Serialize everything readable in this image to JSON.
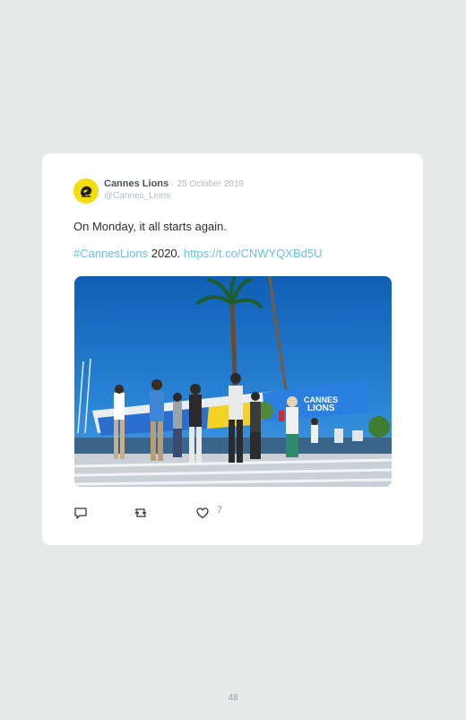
{
  "tweet": {
    "author_name": "Cannes Lions",
    "separator": "·",
    "date": "25 October 2019",
    "handle": "@Cannes_Lions",
    "text_line1": "On Monday, it all starts again.",
    "hashtag": "#CannesLions",
    "year": " 2020. ",
    "link": "https://t.co/CNWYQXBd5U",
    "photo_sign_line1": "CANNES",
    "photo_sign_line2": "LIONS",
    "like_count": "7"
  },
  "icons": {
    "reply": "reply-icon",
    "retweet": "retweet-icon",
    "like": "heart-icon",
    "avatar": "lion-logo"
  },
  "colors": {
    "avatar_bg": "#f5dc0e",
    "link": "#6cc0e8",
    "page_bg": "#e6e9e8"
  },
  "page": {
    "number": "48"
  }
}
